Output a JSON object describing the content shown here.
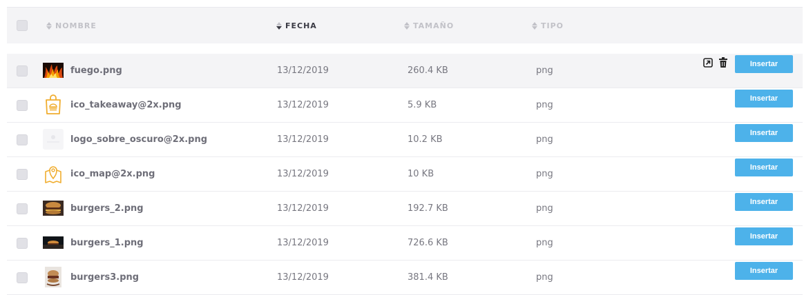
{
  "header": {
    "name": "NOMBRE",
    "date": "FECHA",
    "size": "TAMAÑO",
    "type": "TIPO"
  },
  "insert_label": "Insertar",
  "rows": [
    {
      "name": "fuego.png",
      "date": "13/12/2019",
      "size": "260.4 KB",
      "type": "png",
      "thumb": "fire-thumbnail"
    },
    {
      "name": "ico_takeaway@2x.png",
      "date": "13/12/2019",
      "size": "5.9 KB",
      "type": "png",
      "thumb": "takeaway-bag-icon"
    },
    {
      "name": "logo_sobre_oscuro@2x.png",
      "date": "13/12/2019",
      "size": "10.2 KB",
      "type": "png",
      "thumb": "logo-thumbnail"
    },
    {
      "name": "ico_map@2x.png",
      "date": "13/12/2019",
      "size": "10 KB",
      "type": "png",
      "thumb": "map-pin-icon"
    },
    {
      "name": "burgers_2.png",
      "date": "13/12/2019",
      "size": "192.7 KB",
      "type": "png",
      "thumb": "burger-thumbnail"
    },
    {
      "name": "burgers_1.png",
      "date": "13/12/2019",
      "size": "726.6 KB",
      "type": "png",
      "thumb": "burger-thumbnail"
    },
    {
      "name": "burgers3.png",
      "date": "13/12/2019",
      "size": "381.4 KB",
      "type": "png",
      "thumb": "burger-thumbnail"
    }
  ],
  "colors": {
    "accent": "#4db2ea",
    "header_bg": "#f4f4f6",
    "row_hover": "#f4f4f6",
    "icon_orange": "#f0ad2f"
  }
}
